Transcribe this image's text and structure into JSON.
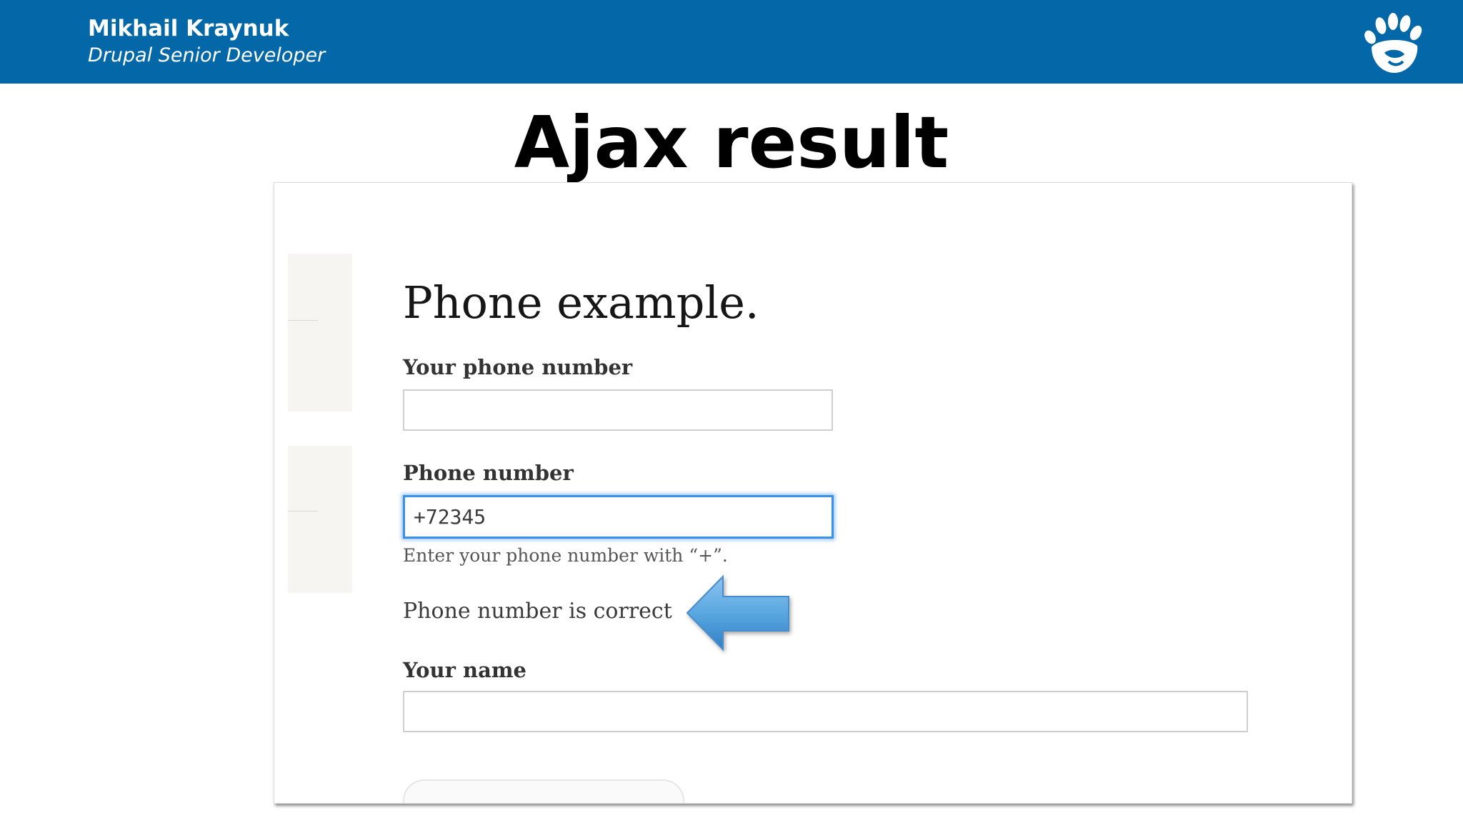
{
  "header": {
    "presenter_name": "Mikhail Kraynuk",
    "presenter_role": "Drupal Senior Developer",
    "logo_icon": "bear-paw-logo-icon",
    "background_color": "#0468a8"
  },
  "slide": {
    "title": "Ajax result"
  },
  "form": {
    "heading": "Phone example.",
    "your_phone_label": "Your phone number",
    "your_phone_value": "",
    "phone_label": "Phone number",
    "phone_value": "+72345",
    "phone_description": "Enter your phone number with “+”.",
    "ajax_message": "Phone number is correct",
    "name_label": "Your name",
    "name_value": "",
    "focus_color": "#3a8fe8"
  },
  "annotation": {
    "arrow_icon": "left-arrow-icon",
    "arrow_color": "#5aa7e0"
  }
}
